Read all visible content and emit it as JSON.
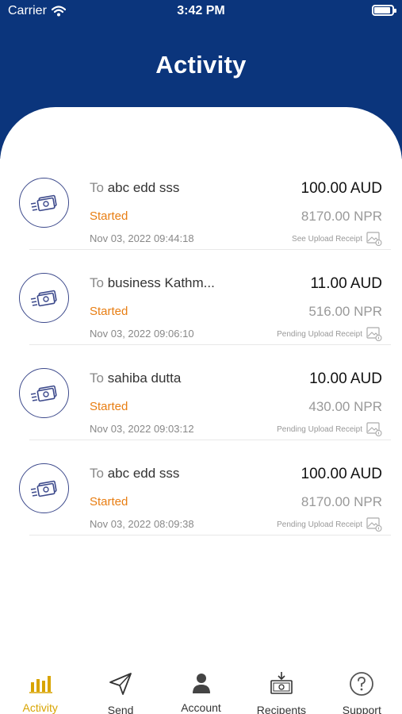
{
  "status_bar": {
    "carrier": "Carrier",
    "time": "3:42 PM"
  },
  "header": {
    "title": "Activity"
  },
  "colors": {
    "primary": "#0b357c",
    "status": "#e87e13",
    "active_tab": "#d8a400"
  },
  "transactions": [
    {
      "to_prefix": "To",
      "recipient": "abc edd sss",
      "status": "Started",
      "date": "Nov 03, 2022 09:44:18",
      "amount": "100.00 AUD",
      "converted": "8170.00 NPR",
      "receipt_label": "See Upload Receipt"
    },
    {
      "to_prefix": "To",
      "recipient": "business Kathm...",
      "status": "Started",
      "date": "Nov 03, 2022 09:06:10",
      "amount": "11.00 AUD",
      "converted": "516.00 NPR",
      "receipt_label": "Pending Upload Receipt"
    },
    {
      "to_prefix": "To",
      "recipient": "sahiba dutta",
      "status": "Started",
      "date": "Nov 03, 2022 09:03:12",
      "amount": "10.00 AUD",
      "converted": "430.00 NPR",
      "receipt_label": "Pending Upload Receipt"
    },
    {
      "to_prefix": "To",
      "recipient": "abc edd sss",
      "status": "Started",
      "date": "Nov 03, 2022 08:09:38",
      "amount": "100.00 AUD",
      "converted": "8170.00 NPR",
      "receipt_label": "Pending Upload Receipt"
    }
  ],
  "tabbar": {
    "items": [
      {
        "label": "Activity",
        "icon": "bar-chart-icon",
        "active": true
      },
      {
        "label": "Send",
        "icon": "send-icon",
        "active": false
      },
      {
        "label": "Account",
        "icon": "person-icon",
        "active": false
      },
      {
        "label": "Recipents",
        "icon": "money-icon",
        "active": false
      },
      {
        "label": "Support",
        "icon": "help-icon",
        "active": false
      }
    ]
  }
}
